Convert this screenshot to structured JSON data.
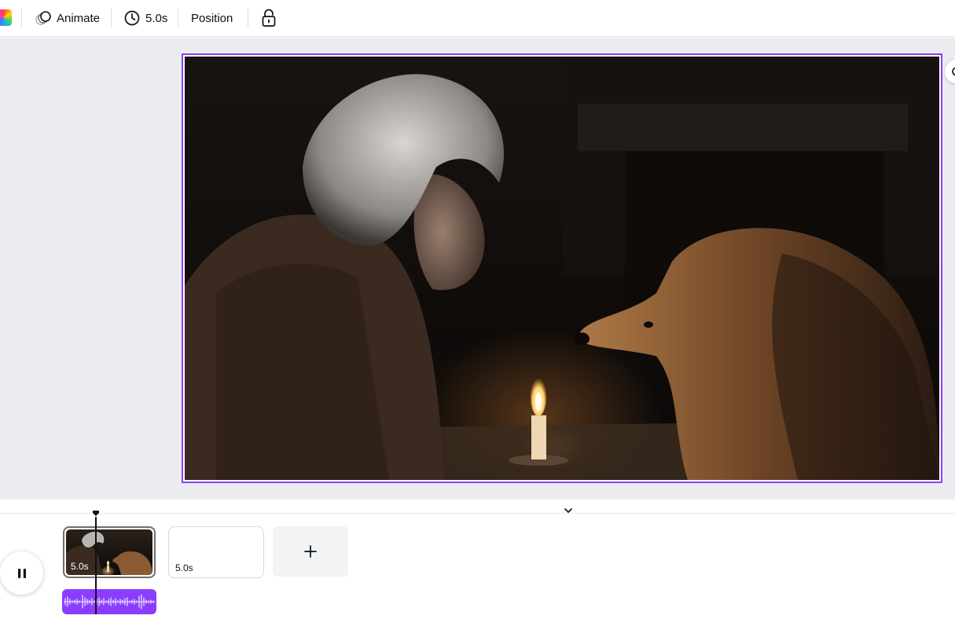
{
  "toolbar": {
    "color_swatch_icon": "rainbow-color-icon",
    "animate_label": "Animate",
    "duration_label": "5.0s",
    "position_label": "Position",
    "lock_icon": "unlock-icon"
  },
  "canvas": {
    "selection_color": "#8b3dff",
    "background_color": "#ebecf0"
  },
  "timeline": {
    "play_state_icon": "pause-icon",
    "clips": [
      {
        "duration": "5.0s"
      },
      {
        "duration": "5.0s"
      }
    ],
    "add_clip_icon": "plus-icon",
    "audio_color": "#8b3dff"
  }
}
